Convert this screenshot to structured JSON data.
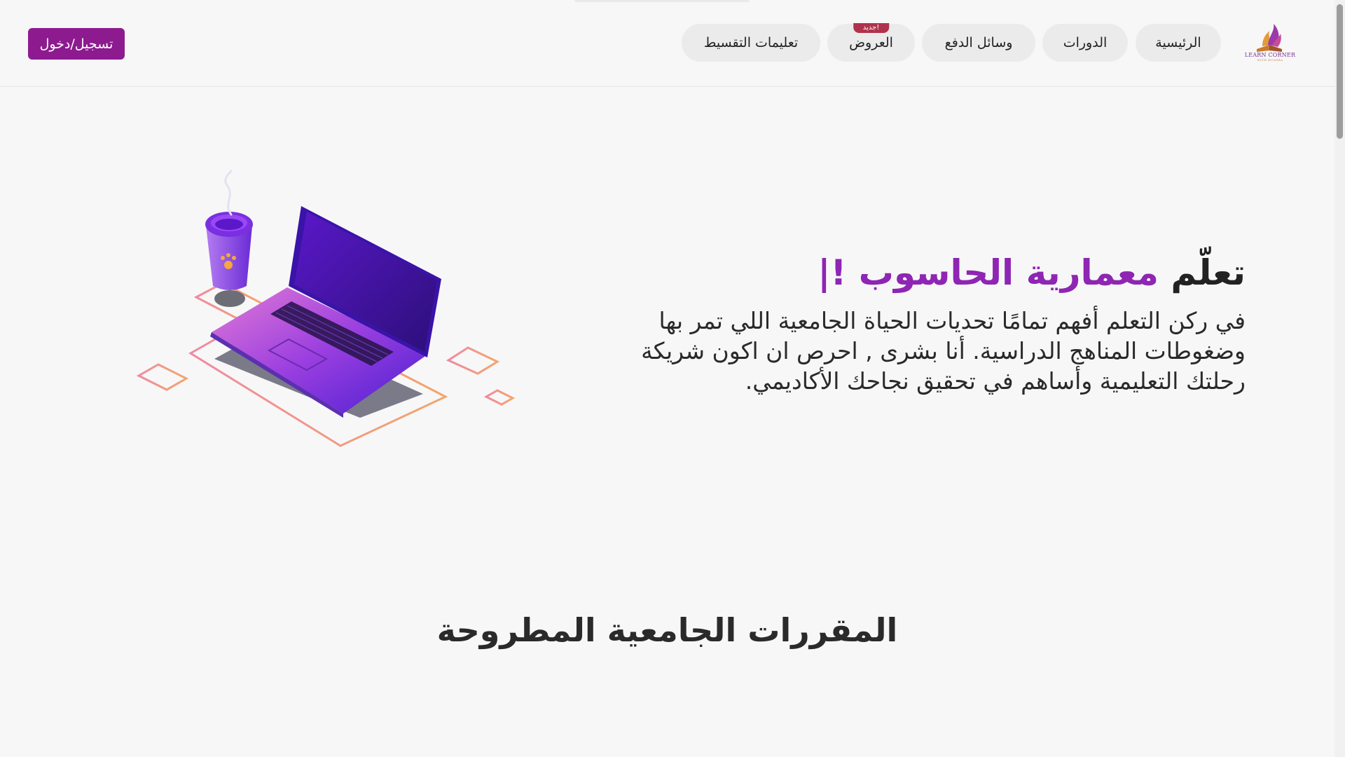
{
  "header": {
    "logo": {
      "name": "LEARN CORNER",
      "tagline": "WITH BUSHRA"
    },
    "nav": [
      {
        "label": "الرئيسية"
      },
      {
        "label": "الدورات"
      },
      {
        "label": "وسائل الدفع"
      },
      {
        "label": "العروض",
        "badge": "جديد!"
      },
      {
        "label": "تعليمات التقسيط"
      }
    ],
    "login_label": "تسجيل/دخول"
  },
  "hero": {
    "title_prefix": "تعلّم",
    "title_accent": "معمارية الحاسوب",
    "title_suffix": "!|",
    "description": "في ركن التعلم أفهم تمامًا تحديات الحياة الجامعية اللي تمر بها وضغوطات المناهج الدراسية. أنا بشرى , احرص ان اكون شريكة رحلتك التعليمية وأساهم في تحقيق نجاحك الأكاديمي."
  },
  "courses_section": {
    "title": "المقررات الجامعية المطروحة"
  },
  "colors": {
    "brand": "#8d1b8f",
    "accent_text": "#8e25b3",
    "badge": "#b0324c",
    "nav_pill": "#ebebec"
  },
  "icons": {
    "logo": "book-flame-logo-icon",
    "illustration": "laptop-coffee-illustration"
  }
}
